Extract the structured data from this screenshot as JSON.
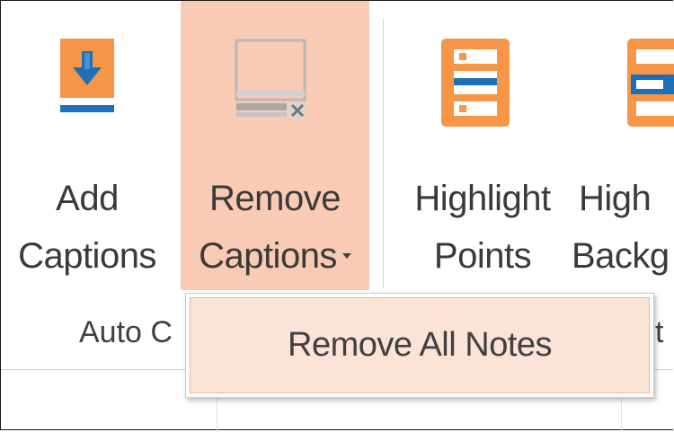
{
  "ribbon": {
    "add_captions": {
      "line1": "Add",
      "line2": "Captions",
      "icon": "add-captions-icon"
    },
    "remove_captions": {
      "line1": "Remove",
      "line2": "Captions",
      "icon": "remove-captions-icon"
    },
    "highlight_points": {
      "line1": "Highlight",
      "line2": "Points",
      "icon": "highlight-points-icon"
    },
    "highlight_background": {
      "line1": "High",
      "line2": "Backg",
      "icon": "highlight-background-icon"
    }
  },
  "groups": {
    "auto_captions": "Auto C",
    "highlight_partial": "t"
  },
  "dropdown": {
    "items": [
      {
        "label": "Remove All Notes"
      }
    ]
  },
  "colors": {
    "accent_orange": "#f79646",
    "accent_blue": "#1f6fb8",
    "hover_fill": "#f9cbb5"
  }
}
